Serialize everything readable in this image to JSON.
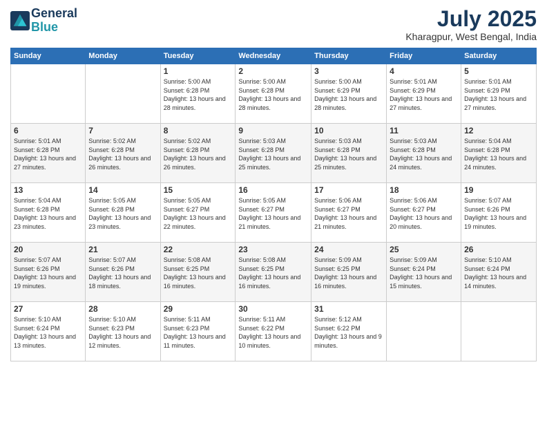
{
  "logo": {
    "line1": "General",
    "line2": "Blue"
  },
  "title": {
    "month_year": "July 2025",
    "location": "Kharagpur, West Bengal, India"
  },
  "weekdays": [
    "Sunday",
    "Monday",
    "Tuesday",
    "Wednesday",
    "Thursday",
    "Friday",
    "Saturday"
  ],
  "weeks": [
    [
      {
        "day": "",
        "sunrise": "",
        "sunset": "",
        "daylight": ""
      },
      {
        "day": "",
        "sunrise": "",
        "sunset": "",
        "daylight": ""
      },
      {
        "day": "1",
        "sunrise": "Sunrise: 5:00 AM",
        "sunset": "Sunset: 6:28 PM",
        "daylight": "Daylight: 13 hours and 28 minutes."
      },
      {
        "day": "2",
        "sunrise": "Sunrise: 5:00 AM",
        "sunset": "Sunset: 6:28 PM",
        "daylight": "Daylight: 13 hours and 28 minutes."
      },
      {
        "day": "3",
        "sunrise": "Sunrise: 5:00 AM",
        "sunset": "Sunset: 6:29 PM",
        "daylight": "Daylight: 13 hours and 28 minutes."
      },
      {
        "day": "4",
        "sunrise": "Sunrise: 5:01 AM",
        "sunset": "Sunset: 6:29 PM",
        "daylight": "Daylight: 13 hours and 27 minutes."
      },
      {
        "day": "5",
        "sunrise": "Sunrise: 5:01 AM",
        "sunset": "Sunset: 6:29 PM",
        "daylight": "Daylight: 13 hours and 27 minutes."
      }
    ],
    [
      {
        "day": "6",
        "sunrise": "Sunrise: 5:01 AM",
        "sunset": "Sunset: 6:28 PM",
        "daylight": "Daylight: 13 hours and 27 minutes."
      },
      {
        "day": "7",
        "sunrise": "Sunrise: 5:02 AM",
        "sunset": "Sunset: 6:28 PM",
        "daylight": "Daylight: 13 hours and 26 minutes."
      },
      {
        "day": "8",
        "sunrise": "Sunrise: 5:02 AM",
        "sunset": "Sunset: 6:28 PM",
        "daylight": "Daylight: 13 hours and 26 minutes."
      },
      {
        "day": "9",
        "sunrise": "Sunrise: 5:03 AM",
        "sunset": "Sunset: 6:28 PM",
        "daylight": "Daylight: 13 hours and 25 minutes."
      },
      {
        "day": "10",
        "sunrise": "Sunrise: 5:03 AM",
        "sunset": "Sunset: 6:28 PM",
        "daylight": "Daylight: 13 hours and 25 minutes."
      },
      {
        "day": "11",
        "sunrise": "Sunrise: 5:03 AM",
        "sunset": "Sunset: 6:28 PM",
        "daylight": "Daylight: 13 hours and 24 minutes."
      },
      {
        "day": "12",
        "sunrise": "Sunrise: 5:04 AM",
        "sunset": "Sunset: 6:28 PM",
        "daylight": "Daylight: 13 hours and 24 minutes."
      }
    ],
    [
      {
        "day": "13",
        "sunrise": "Sunrise: 5:04 AM",
        "sunset": "Sunset: 6:28 PM",
        "daylight": "Daylight: 13 hours and 23 minutes."
      },
      {
        "day": "14",
        "sunrise": "Sunrise: 5:05 AM",
        "sunset": "Sunset: 6:28 PM",
        "daylight": "Daylight: 13 hours and 23 minutes."
      },
      {
        "day": "15",
        "sunrise": "Sunrise: 5:05 AM",
        "sunset": "Sunset: 6:27 PM",
        "daylight": "Daylight: 13 hours and 22 minutes."
      },
      {
        "day": "16",
        "sunrise": "Sunrise: 5:05 AM",
        "sunset": "Sunset: 6:27 PM",
        "daylight": "Daylight: 13 hours and 21 minutes."
      },
      {
        "day": "17",
        "sunrise": "Sunrise: 5:06 AM",
        "sunset": "Sunset: 6:27 PM",
        "daylight": "Daylight: 13 hours and 21 minutes."
      },
      {
        "day": "18",
        "sunrise": "Sunrise: 5:06 AM",
        "sunset": "Sunset: 6:27 PM",
        "daylight": "Daylight: 13 hours and 20 minutes."
      },
      {
        "day": "19",
        "sunrise": "Sunrise: 5:07 AM",
        "sunset": "Sunset: 6:26 PM",
        "daylight": "Daylight: 13 hours and 19 minutes."
      }
    ],
    [
      {
        "day": "20",
        "sunrise": "Sunrise: 5:07 AM",
        "sunset": "Sunset: 6:26 PM",
        "daylight": "Daylight: 13 hours and 19 minutes."
      },
      {
        "day": "21",
        "sunrise": "Sunrise: 5:07 AM",
        "sunset": "Sunset: 6:26 PM",
        "daylight": "Daylight: 13 hours and 18 minutes."
      },
      {
        "day": "22",
        "sunrise": "Sunrise: 5:08 AM",
        "sunset": "Sunset: 6:25 PM",
        "daylight": "Daylight: 13 hours and 16 minutes."
      },
      {
        "day": "23",
        "sunrise": "Sunrise: 5:08 AM",
        "sunset": "Sunset: 6:25 PM",
        "daylight": "Daylight: 13 hours and 16 minutes."
      },
      {
        "day": "24",
        "sunrise": "Sunrise: 5:09 AM",
        "sunset": "Sunset: 6:25 PM",
        "daylight": "Daylight: 13 hours and 16 minutes."
      },
      {
        "day": "25",
        "sunrise": "Sunrise: 5:09 AM",
        "sunset": "Sunset: 6:24 PM",
        "daylight": "Daylight: 13 hours and 15 minutes."
      },
      {
        "day": "26",
        "sunrise": "Sunrise: 5:10 AM",
        "sunset": "Sunset: 6:24 PM",
        "daylight": "Daylight: 13 hours and 14 minutes."
      }
    ],
    [
      {
        "day": "27",
        "sunrise": "Sunrise: 5:10 AM",
        "sunset": "Sunset: 6:24 PM",
        "daylight": "Daylight: 13 hours and 13 minutes."
      },
      {
        "day": "28",
        "sunrise": "Sunrise: 5:10 AM",
        "sunset": "Sunset: 6:23 PM",
        "daylight": "Daylight: 13 hours and 12 minutes."
      },
      {
        "day": "29",
        "sunrise": "Sunrise: 5:11 AM",
        "sunset": "Sunset: 6:23 PM",
        "daylight": "Daylight: 13 hours and 11 minutes."
      },
      {
        "day": "30",
        "sunrise": "Sunrise: 5:11 AM",
        "sunset": "Sunset: 6:22 PM",
        "daylight": "Daylight: 13 hours and 10 minutes."
      },
      {
        "day": "31",
        "sunrise": "Sunrise: 5:12 AM",
        "sunset": "Sunset: 6:22 PM",
        "daylight": "Daylight: 13 hours and 9 minutes."
      },
      {
        "day": "",
        "sunrise": "",
        "sunset": "",
        "daylight": ""
      },
      {
        "day": "",
        "sunrise": "",
        "sunset": "",
        "daylight": ""
      }
    ]
  ]
}
